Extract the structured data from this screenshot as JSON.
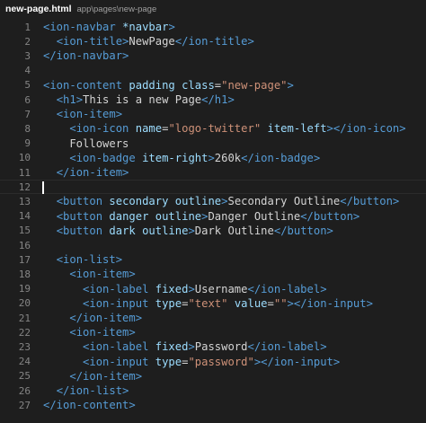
{
  "tab": {
    "filename": "new-page.html",
    "path": "app\\pages\\new-page"
  },
  "colors": {
    "background": "#1e1e1e",
    "tag": "#569cd6",
    "attribute": "#9cdcfe",
    "string": "#ce9178",
    "text": "#d4d4d4",
    "line_number": "#858585"
  },
  "active_line": 12,
  "lines": [
    {
      "n": "1",
      "tokens": [
        [
          "tag",
          "<ion-navbar "
        ],
        [
          "attr",
          "*navbar"
        ],
        [
          "tag",
          ">"
        ]
      ]
    },
    {
      "n": "2",
      "tokens": [
        [
          "txt",
          "  "
        ],
        [
          "tag",
          "<ion-title>"
        ],
        [
          "txt",
          "NewPage"
        ],
        [
          "tag",
          "</ion-title>"
        ]
      ]
    },
    {
      "n": "3",
      "tokens": [
        [
          "tag",
          "</ion-navbar>"
        ]
      ]
    },
    {
      "n": "4",
      "tokens": []
    },
    {
      "n": "5",
      "tokens": [
        [
          "tag",
          "<ion-content "
        ],
        [
          "attr",
          "padding class"
        ],
        [
          "txt",
          "="
        ],
        [
          "str",
          "\"new-page\""
        ],
        [
          "tag",
          ">"
        ]
      ]
    },
    {
      "n": "6",
      "tokens": [
        [
          "txt",
          "  "
        ],
        [
          "tag",
          "<h1>"
        ],
        [
          "txt",
          "This is a new Page"
        ],
        [
          "tag",
          "</h1>"
        ]
      ]
    },
    {
      "n": "7",
      "tokens": [
        [
          "txt",
          "  "
        ],
        [
          "tag",
          "<ion-item>"
        ]
      ]
    },
    {
      "n": "8",
      "tokens": [
        [
          "txt",
          "    "
        ],
        [
          "tag",
          "<ion-icon "
        ],
        [
          "attr",
          "name"
        ],
        [
          "txt",
          "="
        ],
        [
          "str",
          "\"logo-twitter\""
        ],
        [
          "attr",
          " item-left"
        ],
        [
          "tag",
          "></ion-icon>"
        ]
      ]
    },
    {
      "n": "9",
      "tokens": [
        [
          "txt",
          "    Followers"
        ]
      ]
    },
    {
      "n": "10",
      "tokens": [
        [
          "txt",
          "    "
        ],
        [
          "tag",
          "<ion-badge "
        ],
        [
          "attr",
          "item-right"
        ],
        [
          "tag",
          ">"
        ],
        [
          "txt",
          "260k"
        ],
        [
          "tag",
          "</ion-badge>"
        ]
      ]
    },
    {
      "n": "11",
      "tokens": [
        [
          "txt",
          "  "
        ],
        [
          "tag",
          "</ion-item>"
        ]
      ]
    },
    {
      "n": "12",
      "tokens": []
    },
    {
      "n": "13",
      "tokens": [
        [
          "txt",
          "  "
        ],
        [
          "tag",
          "<button "
        ],
        [
          "attr",
          "secondary outline"
        ],
        [
          "tag",
          ">"
        ],
        [
          "txt",
          "Secondary Outline"
        ],
        [
          "tag",
          "</button>"
        ]
      ]
    },
    {
      "n": "14",
      "tokens": [
        [
          "txt",
          "  "
        ],
        [
          "tag",
          "<button "
        ],
        [
          "attr",
          "danger outline"
        ],
        [
          "tag",
          ">"
        ],
        [
          "txt",
          "Danger Outline"
        ],
        [
          "tag",
          "</button>"
        ]
      ]
    },
    {
      "n": "15",
      "tokens": [
        [
          "txt",
          "  "
        ],
        [
          "tag",
          "<button "
        ],
        [
          "attr",
          "dark outline"
        ],
        [
          "tag",
          ">"
        ],
        [
          "txt",
          "Dark Outline"
        ],
        [
          "tag",
          "</button>"
        ]
      ]
    },
    {
      "n": "16",
      "tokens": []
    },
    {
      "n": "17",
      "tokens": [
        [
          "txt",
          "  "
        ],
        [
          "tag",
          "<ion-list>"
        ]
      ]
    },
    {
      "n": "18",
      "tokens": [
        [
          "txt",
          "    "
        ],
        [
          "tag",
          "<ion-item>"
        ]
      ]
    },
    {
      "n": "19",
      "tokens": [
        [
          "txt",
          "      "
        ],
        [
          "tag",
          "<ion-label "
        ],
        [
          "attr",
          "fixed"
        ],
        [
          "tag",
          ">"
        ],
        [
          "txt",
          "Username"
        ],
        [
          "tag",
          "</ion-label>"
        ]
      ]
    },
    {
      "n": "20",
      "tokens": [
        [
          "txt",
          "      "
        ],
        [
          "tag",
          "<ion-input "
        ],
        [
          "attr",
          "type"
        ],
        [
          "txt",
          "="
        ],
        [
          "str",
          "\"text\""
        ],
        [
          "attr",
          " value"
        ],
        [
          "txt",
          "="
        ],
        [
          "str",
          "\"\""
        ],
        [
          "tag",
          "></ion-input>"
        ]
      ]
    },
    {
      "n": "21",
      "tokens": [
        [
          "txt",
          "    "
        ],
        [
          "tag",
          "</ion-item>"
        ]
      ]
    },
    {
      "n": "22",
      "tokens": [
        [
          "txt",
          "    "
        ],
        [
          "tag",
          "<ion-item>"
        ]
      ]
    },
    {
      "n": "23",
      "tokens": [
        [
          "txt",
          "      "
        ],
        [
          "tag",
          "<ion-label "
        ],
        [
          "attr",
          "fixed"
        ],
        [
          "tag",
          ">"
        ],
        [
          "txt",
          "Password"
        ],
        [
          "tag",
          "</ion-label>"
        ]
      ]
    },
    {
      "n": "24",
      "tokens": [
        [
          "txt",
          "      "
        ],
        [
          "tag",
          "<ion-input "
        ],
        [
          "attr",
          "type"
        ],
        [
          "txt",
          "="
        ],
        [
          "str",
          "\"password\""
        ],
        [
          "tag",
          "></ion-input>"
        ]
      ]
    },
    {
      "n": "25",
      "tokens": [
        [
          "txt",
          "    "
        ],
        [
          "tag",
          "</ion-item>"
        ]
      ]
    },
    {
      "n": "26",
      "tokens": [
        [
          "txt",
          "  "
        ],
        [
          "tag",
          "</ion-list>"
        ]
      ]
    },
    {
      "n": "27",
      "tokens": [
        [
          "tag",
          "</ion-content>"
        ]
      ]
    }
  ]
}
